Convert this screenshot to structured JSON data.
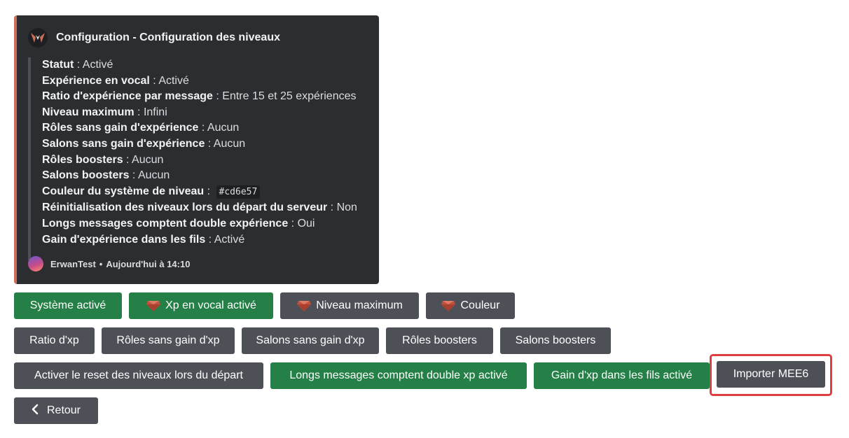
{
  "embed": {
    "title": "Configuration - Configuration des niveaux",
    "accent_color": "#cd6e57",
    "fields": [
      {
        "label": "Statut",
        "value": "Activé"
      },
      {
        "label": "Expérience en vocal",
        "value": "Activé"
      },
      {
        "label": "Ratio d'expérience par message",
        "value": "Entre 15 et 25 expériences"
      },
      {
        "label": "Niveau maximum",
        "value": "Infini"
      },
      {
        "label": "Rôles sans gain d'expérience",
        "value": "Aucun"
      },
      {
        "label": "Salons sans gain d'expérience",
        "value": "Aucun"
      },
      {
        "label": "Rôles boosters",
        "value": "Aucun"
      },
      {
        "label": "Salons boosters",
        "value": "Aucun"
      },
      {
        "label": "Couleur du système de niveau",
        "value": "#cd6e57"
      },
      {
        "label": "Réinitialisation des niveaux lors du départ du serveur",
        "value": "Non"
      },
      {
        "label": "Longs messages comptent double expérience",
        "value": "Oui"
      },
      {
        "label": "Gain d'expérience dans les fils",
        "value": "Activé"
      }
    ],
    "footer": {
      "author": "ErwanTest",
      "separator": "•",
      "timestamp": "Aujourd'hui à 14:10"
    }
  },
  "buttons": {
    "row1": {
      "system": "Système activé",
      "vocal": "Xp en vocal activé",
      "max_level": "Niveau maximum",
      "color": "Couleur"
    },
    "row2": {
      "ratio": "Ratio d'xp",
      "roles_no_xp": "Rôles sans gain d'xp",
      "salons_no_xp": "Salons sans gain d'xp",
      "roles_boosters": "Rôles boosters",
      "salons_boosters": "Salons boosters"
    },
    "row3": {
      "reset": "Activer le reset des niveaux lors du départ",
      "long_messages": "Longs messages comptent double xp activé",
      "threads": "Gain d'xp dans les fils activé",
      "import": "Importer MEE6"
    },
    "back": "Retour"
  },
  "icons": {
    "bot": "bot-logo-icon",
    "gem": "ruby-gem-icon",
    "back": "chevron-left-icon"
  },
  "colors": {
    "green": "#248046",
    "gray": "#4e5058",
    "embed_bg": "#2b2d31",
    "highlight": "#e03e3e"
  }
}
